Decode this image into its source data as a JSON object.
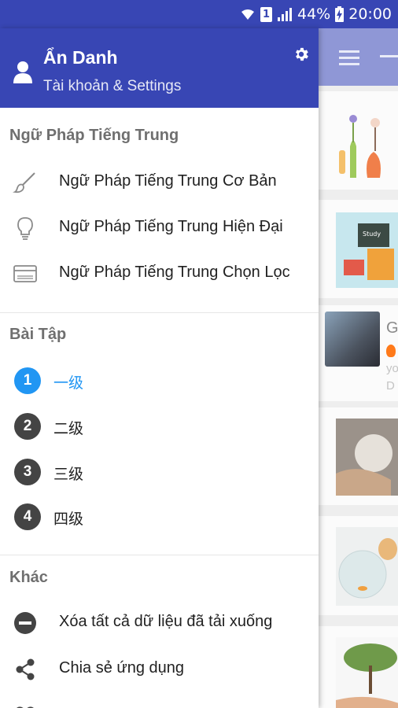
{
  "status_bar": {
    "battery": "44%",
    "time": "20:00",
    "sim_slot": "1"
  },
  "header": {
    "user_name": "Ẩn Danh",
    "subtitle": "Tài khoản & Settings"
  },
  "sections": {
    "grammar": {
      "title": "Ngữ Pháp Tiếng Trung",
      "items": [
        {
          "label": "Ngữ Pháp Tiếng Trung Cơ Bản",
          "icon": "brush-icon"
        },
        {
          "label": "Ngữ Pháp Tiếng Trung Hiện Đại",
          "icon": "lightbulb-icon"
        },
        {
          "label": "Ngữ Pháp Tiếng Trung Chọn Lọc",
          "icon": "card-icon"
        }
      ]
    },
    "exercises": {
      "title": "Bài Tập",
      "items": [
        {
          "number": "1",
          "label": "一级",
          "active": true
        },
        {
          "number": "2",
          "label": "二级",
          "active": false
        },
        {
          "number": "3",
          "label": "三级",
          "active": false
        },
        {
          "number": "4",
          "label": "四级",
          "active": false
        }
      ]
    },
    "other": {
      "title": "Khác",
      "items": [
        {
          "label": "Xóa tất cả dữ liệu đã tải xuống",
          "icon": "remove-circle-icon"
        },
        {
          "label": "Chia sẻ ứng dụng",
          "icon": "share-icon"
        }
      ]
    }
  },
  "background": {
    "card_title_initial": "G",
    "card_text": [
      "yo",
      "D"
    ]
  },
  "colors": {
    "primary": "#3846b4",
    "accent": "#2196f3",
    "level_badge": "#444444"
  }
}
